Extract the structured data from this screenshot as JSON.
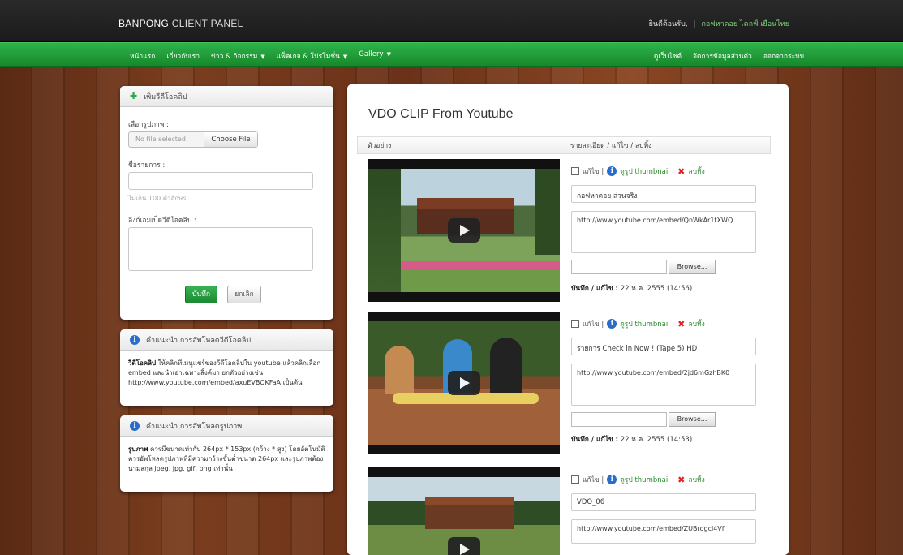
{
  "header": {
    "brand_bold": "BANPONG",
    "brand_rest": " CLIENT PANEL",
    "welcome": "ยินดีต้อนรับ,",
    "separator": "|",
    "user": "กอฟหาดอย ไคลฟ์ เยือนไทย"
  },
  "nav": {
    "left": [
      {
        "label": "หน้าแรก",
        "caret": false
      },
      {
        "label": "เกี่ยวกับเรา",
        "caret": false
      },
      {
        "label": "ข่าว & กิจกรรม",
        "caret": true
      },
      {
        "label": "แพ็คเกจ & โปรโมชั่น",
        "caret": true
      },
      {
        "label": "Gallery",
        "caret": true
      }
    ],
    "right": [
      {
        "label": "ดูเว็บไซต์"
      },
      {
        "label": "จัดการข้อมูลส่วนตัว"
      },
      {
        "label": "ออกจากระบบ"
      }
    ]
  },
  "add_panel": {
    "title": "เพิ่มวีดีโอคลิป",
    "image_label": "เลือกรูปภาพ :",
    "no_file": "No file selected",
    "choose_file": "Choose File",
    "name_label": "ชื่อรายการ :",
    "name_value": "",
    "hint": "ไม่เกิน 100 ตัวอักษร",
    "embed_label": "ลิงก์เอมเบ็ดวีดีโอคลิป :",
    "embed_value": "",
    "save": "บันทึก",
    "cancel": "ยกเลิก"
  },
  "note_video": {
    "title": "คำแนะนำ การอัพโหลดวีดีโอคลิป",
    "bold": "วีดีโอคลิป",
    "text": " ให้คลิกที่เมนูแชร์ของวีดีโอคลิปใน youtube แล้วคลิกเลือก embed และนำเอาเฉพาะลิ้งค์มา ยกตัวอย่างเช่น http://www.youtube.com/embed/axuEVBOKFaA เป็นต้น"
  },
  "note_image": {
    "title": "คำแนะนำ การอัพโหลดรูปภาพ",
    "bold": "รูปภาพ",
    "text": " ควรมีขนาดเท่ากับ 264px * 153px (กว้าง * สูง) โดยอัตโนมัติ ควรอัพโหลดรูปภาพที่มีความกว้างขั้นต่ำขนาด 264px และรูปภาพต้องนามสกุล jpeg, jpg, gif, png เท่านั้น"
  },
  "main": {
    "title": "VDO CLIP From Youtube",
    "col_example": "ตัวอย่าง",
    "col_actions": "รายละเอียด / แก้ไข / ลบทิ้ง",
    "edit_label": "แก้ไข |",
    "thumb_label": "ดูรูป thumbnail |",
    "delete_label": "ลบทิ้ง",
    "browse_label": "Browse...",
    "saved_prefix": "บันทึก / แก้ไข :",
    "items": [
      {
        "name": "กอฟหาดอย ส่วนจริง",
        "url": "http://www.youtube.com/embed/QnWkAr1tXWQ",
        "saved": " 22 ห.ค. 2555 (14:56)"
      },
      {
        "name": "รายการ Check in Now ! (Tape 5) HD",
        "url": "http://www.youtube.com/embed/2jd6mGzhBK0",
        "saved": " 22 ห.ค. 2555 (14:53)"
      },
      {
        "name": "VDO_06",
        "url": "http://www.youtube.com/embed/ZUBrogcl4Vf",
        "saved": ""
      }
    ]
  },
  "icons": {
    "plus": "plus-icon",
    "info": "info-icon",
    "delete": "x-icon",
    "play": "play-icon"
  },
  "colors": {
    "nav_green": "#1f9d3a",
    "topbar": "#222222",
    "info_blue": "#2a6dc9",
    "delete_red": "#dd2222"
  }
}
